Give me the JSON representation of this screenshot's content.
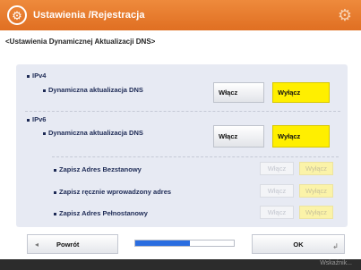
{
  "header": {
    "title": "Ustawienia /Rejestracja",
    "icon": "settings-register-icon",
    "settings_icon": "gear-icon"
  },
  "subtitle": "<Ustawienia Dynamicznej Aktualizacji DNS>",
  "ipv4": {
    "label": "IPv4",
    "option_label": "Dynamiczna aktualizacja DNS",
    "on_label": "Włącz",
    "off_label": "Wyłącz",
    "selected": "Wyłącz"
  },
  "ipv6": {
    "label": "IPv6",
    "option_label": "Dynamiczna aktualizacja DNS",
    "on_label": "Włącz",
    "off_label": "Wyłącz",
    "selected": "Wyłącz",
    "sub_options": [
      {
        "label": "Zapisz Adres Bezstanowy",
        "on_label": "Włącz",
        "off_label": "Wyłącz",
        "selected": "Wyłącz"
      },
      {
        "label": "Zapisz ręcznie wprowadzony adres",
        "on_label": "Włącz",
        "off_label": "Wyłącz",
        "selected": "Wyłącz"
      },
      {
        "label": "Zapisz Adres Pełnostanowy",
        "on_label": "Włącz",
        "off_label": "Wyłącz",
        "selected": "Wyłącz"
      }
    ]
  },
  "footer": {
    "back_label": "Powrót",
    "back_icon": "back-arrow-icon",
    "ok_label": "OK",
    "ok_icon": "corner-arrow-icon",
    "progress": 0.55
  },
  "statusbar": {
    "text": "Wskaźnik..."
  },
  "colors": {
    "title_bar": "#e5772a",
    "selected": "#ffef00",
    "progress": "#2a6de0"
  }
}
